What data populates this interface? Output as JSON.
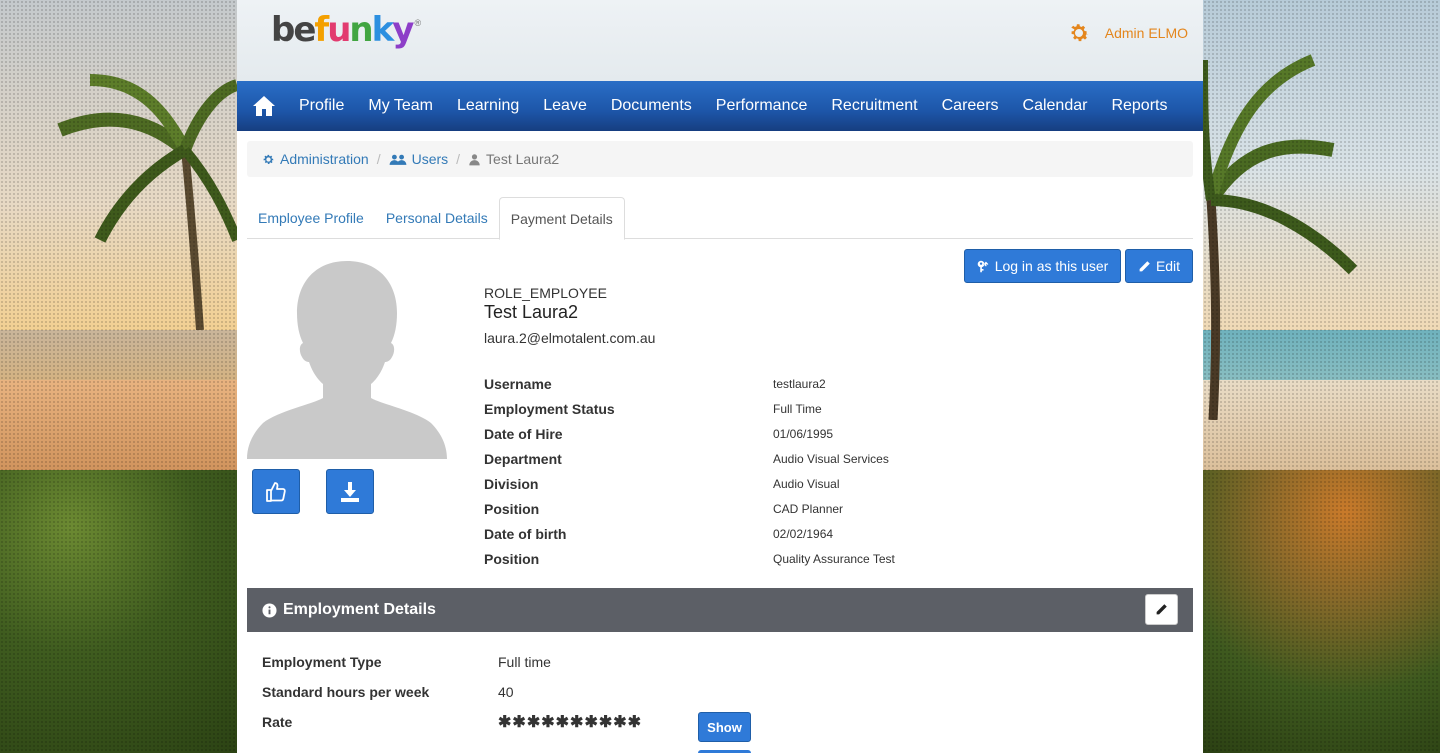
{
  "header": {
    "logo": {
      "letters": [
        "b",
        "e",
        "f",
        "u",
        "n",
        "k",
        "y"
      ],
      "reg": "®"
    },
    "user_label": "Admin ELMO",
    "colors": {
      "accent": "#e4861d",
      "nav": "#1d56a9",
      "primary": "#2f7ad8"
    }
  },
  "nav": {
    "items": [
      "Profile",
      "My Team",
      "Learning",
      "Leave",
      "Documents",
      "Performance",
      "Recruitment",
      "Careers",
      "Calendar",
      "Reports"
    ]
  },
  "breadcrumb": {
    "administration": "Administration",
    "users": "Users",
    "current": "Test Laura2",
    "separator": "/"
  },
  "tabs": {
    "items": [
      "Employee Profile",
      "Personal Details",
      "Payment Details"
    ],
    "active": "Payment Details"
  },
  "actions": {
    "login_as": "Log in as this user",
    "edit": "Edit"
  },
  "profile": {
    "role": "ROLE_EMPLOYEE",
    "name": "Test Laura2",
    "email": "laura.2@elmotalent.com.au",
    "fields": [
      {
        "label": "Username",
        "value": "testlaura2"
      },
      {
        "label": "Employment Status",
        "value": "Full Time"
      },
      {
        "label": "Date of Hire",
        "value": "01/06/1995"
      },
      {
        "label": "Department",
        "value": "Audio Visual Services"
      },
      {
        "label": "Division",
        "value": "Audio Visual"
      },
      {
        "label": "Position",
        "value": "CAD Planner"
      },
      {
        "label": "Date of birth",
        "value": "02/02/1964"
      },
      {
        "label": "Position",
        "value": "Quality Assurance Test"
      }
    ]
  },
  "employment": {
    "title": "Employment Details",
    "rows": [
      {
        "label": "Employment Type",
        "value": "Full time"
      },
      {
        "label": "Standard hours per week",
        "value": "40"
      },
      {
        "label": "Rate",
        "value": "✱✱✱✱✱✱✱✱✱✱"
      }
    ],
    "show_label": "Show"
  }
}
